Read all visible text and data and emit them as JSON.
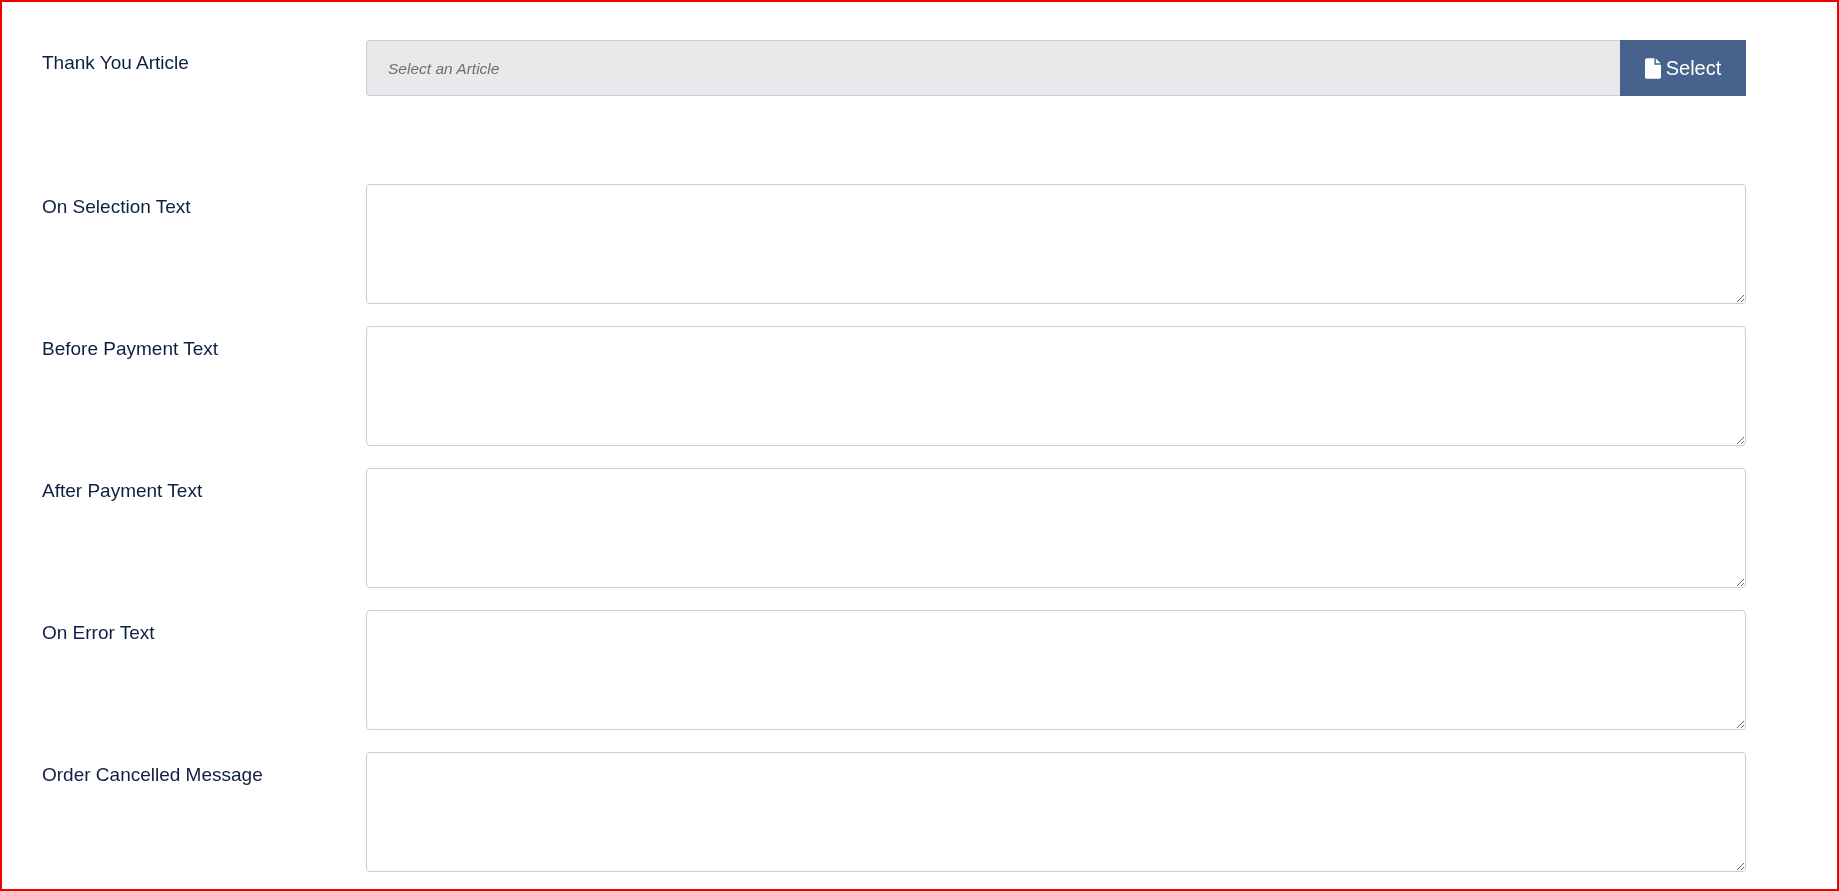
{
  "article_selector": {
    "label": "Thank You Article",
    "placeholder": "Select an Article",
    "readonly": true,
    "button": "Select"
  },
  "text_fields": [
    {
      "label": "On Selection Text"
    },
    {
      "label": "Before Payment Text"
    },
    {
      "label": "After Payment Text"
    },
    {
      "label": "On Error Text"
    },
    {
      "label": "Order Cancelled Message"
    }
  ]
}
